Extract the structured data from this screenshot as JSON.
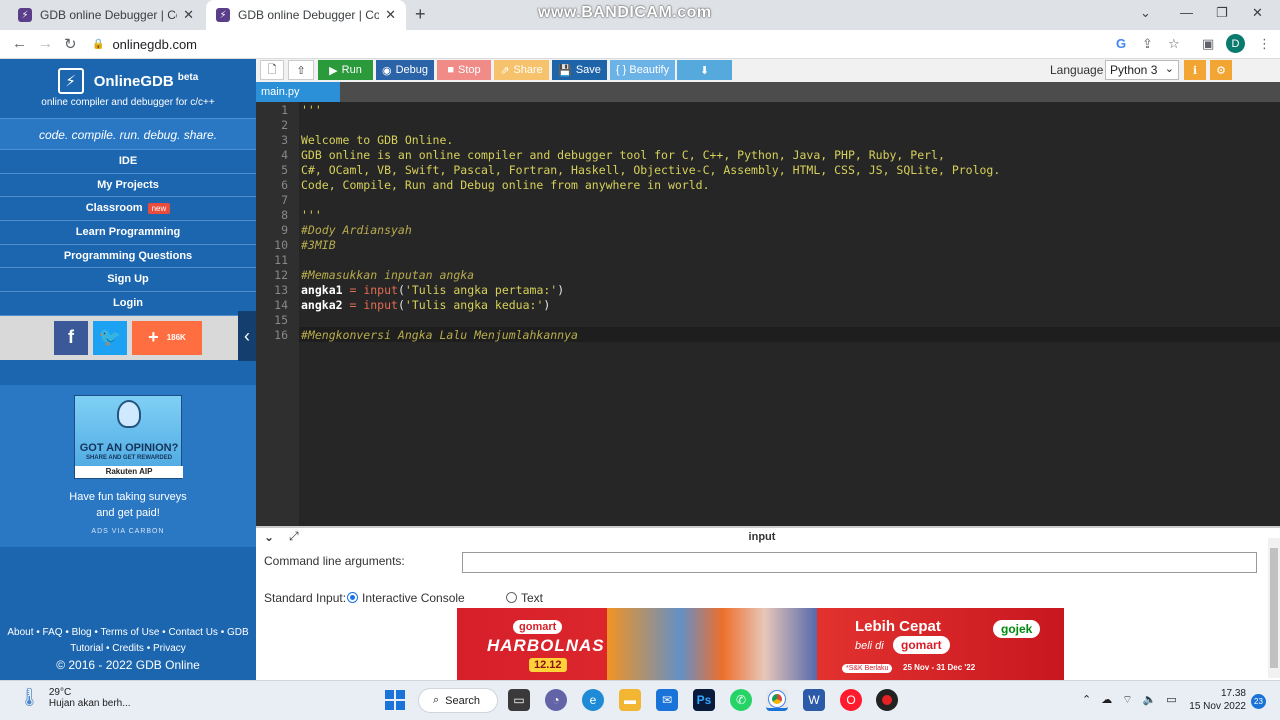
{
  "browser": {
    "tabs": [
      {
        "title": "GDB online Debugger | Compiler - Code, Compile, Run, Debug online C, C++"
      },
      {
        "title": "GDB online Debugger | Compiler - Code, Compile, Run, Debug online C, C++"
      }
    ],
    "watermark": "www.BANDICAM.com",
    "url": "onlinegdb.com",
    "profile_initial": "D"
  },
  "sidebar": {
    "brand": "OnlineGDB",
    "brand_sup": "beta",
    "subtitle": "online compiler and debugger for c/c++",
    "tagline": "code. compile. run. debug. share.",
    "menu": [
      {
        "label": "IDE"
      },
      {
        "label": "My Projects"
      },
      {
        "label": "Classroom",
        "badge": "new"
      },
      {
        "label": "Learn Programming"
      },
      {
        "label": "Programming Questions"
      },
      {
        "label": "Sign Up"
      },
      {
        "label": "Login"
      }
    ],
    "social": {
      "facebook": "f",
      "twitter": "t",
      "share": "+",
      "share_count": "186K"
    },
    "ad": {
      "headline": "GOT AN OPINION?",
      "subheadline": "SHARE AND GET REWARDED",
      "brand": "Rakuten AIP",
      "text_line1": "Have fun taking surveys",
      "text_line2": "and get paid!",
      "via": "ADS VIA CARBON"
    },
    "footer": {
      "line1": "About • FAQ • Blog • Terms of Use • Contact Us • GDB",
      "line2": "Tutorial • Credits • Privacy",
      "copyright": "© 2016 - 2022 GDB Online"
    }
  },
  "toolbar": {
    "run": "Run",
    "debug": "Debug",
    "stop": "Stop",
    "share": "Share",
    "save": "Save",
    "beautify": "{ } Beautify",
    "language_label": "Language",
    "language_value": "Python 3"
  },
  "editor": {
    "filename": "main.py",
    "lines": [
      "'''",
      "",
      "Welcome to GDB Online.",
      "GDB online is an online compiler and debugger tool for C, C++, Python, Java, PHP, Ruby, Perl,",
      "C#, OCaml, VB, Swift, Pascal, Fortran, Haskell, Objective-C, Assembly, HTML, CSS, JS, SQLite, Prolog.",
      "Code, Compile, Run and Debug online from anywhere in world.",
      "",
      "'''",
      "#Dody Ardiansyah",
      "#3MIB",
      "",
      "#Memasukkan inputan angka",
      "angka1 = input('Tulis angka pertama:')",
      "angka2 = input('Tulis angka kedua:')",
      "",
      "#Mengkonversi Angka Lalu Menjumlahkannya"
    ],
    "line_numbers": [
      "1",
      "2",
      "3",
      "4",
      "5",
      "6",
      "7",
      "8",
      "9",
      "10",
      "11",
      "12",
      "13",
      "14",
      "15",
      "16"
    ]
  },
  "input_panel": {
    "title": "input",
    "cmd_label": "Command line arguments:",
    "cmd_value": "",
    "stdin_label": "Standard Input:",
    "option_interactive": "Interactive Console",
    "option_text": "Text",
    "selected": "Interactive Console"
  },
  "banner": {
    "gomart": "gomart",
    "harbolnas": "HARBOLNAS",
    "date_tag": "12.12",
    "lebih": "Lebih Cepat",
    "beli_di": "beli di",
    "gomart2": "gomart",
    "gojek": "gojek",
    "snk": "*S&K Berlaku",
    "dates": "25 Nov - 31 Dec '22"
  },
  "taskbar": {
    "temperature": "29°C",
    "weather": "Hujan akan berh...",
    "search": "Search",
    "time": "17.38",
    "date": "15 Nov 2022",
    "notification_count": "23"
  }
}
